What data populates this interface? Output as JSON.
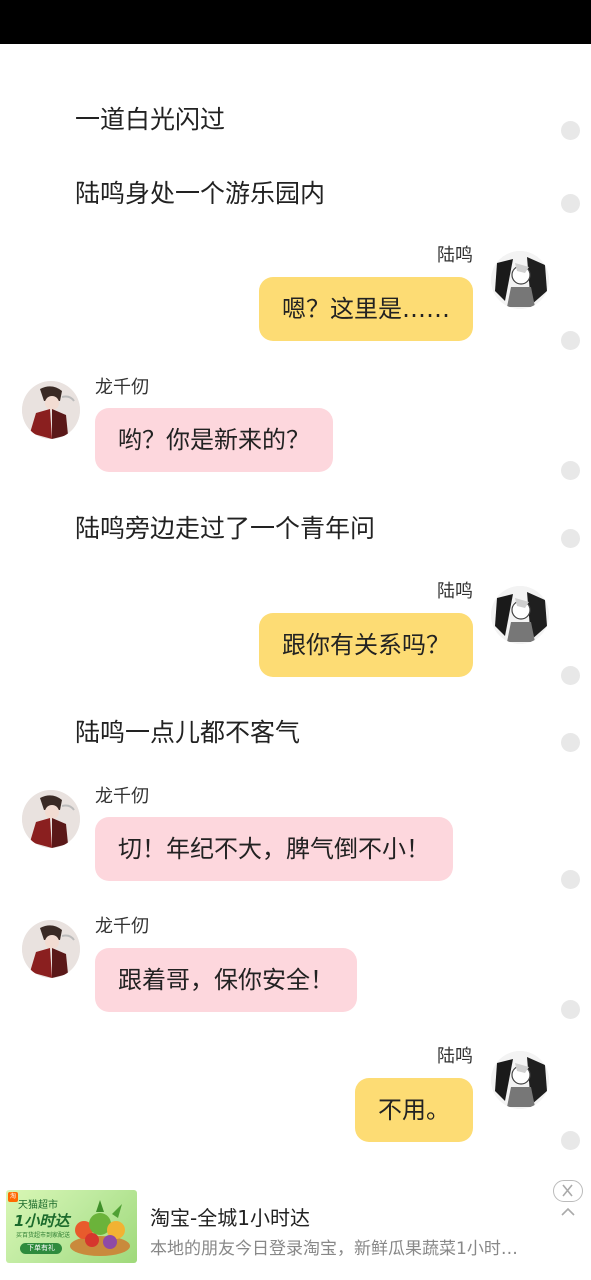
{
  "messages": {
    "m1_narration": "一道白光闪过",
    "m2_narration": "陆鸣身处一个游乐园内",
    "m3_name": "陆鸣",
    "m3_text": "嗯？这里是……",
    "m4_name": "龙千仞",
    "m4_text": "哟？你是新来的？",
    "m5_narration": "陆鸣旁边走过了一个青年问",
    "m6_name": "陆鸣",
    "m6_text": "跟你有关系吗？",
    "m7_narration": "陆鸣一点儿都不客气",
    "m8_name": "龙千仞",
    "m8_text": "切！年纪不大，脾气倒不小！",
    "m9_name": "龙千仞",
    "m9_text": "跟着哥，保你安全！",
    "m10_name": "陆鸣",
    "m10_text": "不用。"
  },
  "ad": {
    "title": "淘宝-全城1小时达",
    "description": "本地的朋友今日登录淘宝，新鲜瓜果蔬菜1小时…",
    "thumb_title": "天猫超市",
    "thumb_big": "1小时达",
    "thumb_sub": "买百货超市到家配送",
    "thumb_button": "下单有礼",
    "thumb_badge": "淘"
  },
  "icons": {
    "close": "close-icon",
    "collapse": "chevron-up-icon"
  },
  "colors": {
    "right_bubble": "#fddc74",
    "left_bubble": "#fdd7dd",
    "status_bar": "#000000"
  }
}
